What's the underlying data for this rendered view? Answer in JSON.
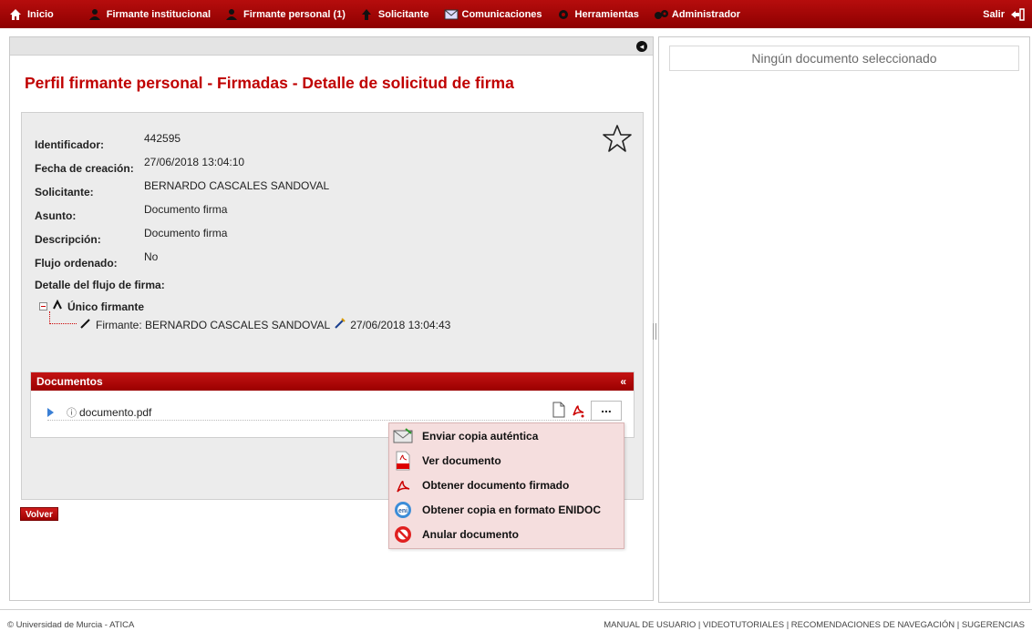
{
  "nav": {
    "items": [
      {
        "label": "Inicio",
        "icon": "home-icon"
      },
      {
        "label": "Firmante institucional",
        "icon": "user-icon"
      },
      {
        "label": "Firmante personal (1)",
        "icon": "user-icon"
      },
      {
        "label": "Solicitante",
        "icon": "arrow-up-icon"
      },
      {
        "label": "Comunicaciones",
        "icon": "envelope-icon"
      },
      {
        "label": "Herramientas",
        "icon": "gear-icon"
      },
      {
        "label": "Administrador",
        "icon": "gears-icon"
      }
    ],
    "logout": {
      "label": "Salir",
      "icon": "logout-icon"
    }
  },
  "right_panel": {
    "empty_text": "Ningún documento seleccionado"
  },
  "page": {
    "title": "Perfil firmante personal - Firmadas - Detalle de solicitud de firma"
  },
  "fields": [
    {
      "label": "Identificador:",
      "value": "442595"
    },
    {
      "label": "Fecha de creación:",
      "value": "27/06/2018 13:04:10"
    },
    {
      "label": "Solicitante:",
      "value": "BERNARDO CASCALES SANDOVAL"
    },
    {
      "label": "Asunto:",
      "value": "Documento firma"
    },
    {
      "label": "Descripción:",
      "value": "Documento firma"
    },
    {
      "label": "Flujo ordenado:",
      "value": "No"
    }
  ],
  "flow": {
    "title": "Detalle del flujo de firma:",
    "root": "Único firmante",
    "signer_text": "Firmante: BERNARDO CASCALES SANDOVAL",
    "signed_date": "27/06/2018 13:04:43"
  },
  "documents": {
    "header": "Documentos",
    "collapse": "«",
    "file_name": "documento.pdf",
    "more_label": "..."
  },
  "menu": [
    {
      "label": "Enviar copia auténtica",
      "icon": "envelope-icon"
    },
    {
      "label": "Ver documento",
      "icon": "pdf-icon"
    },
    {
      "label": "Obtener documento firmado",
      "icon": "acrobat-icon"
    },
    {
      "label": "Obtener copia en formato ENIDOC",
      "icon": "eni-icon"
    },
    {
      "label": "Anular documento",
      "icon": "cancel-icon"
    }
  ],
  "actions": {
    "back_label": "Volver"
  },
  "footer": {
    "left": "© Universidad de Murcia - ATICA",
    "right": "MANUAL DE USUARIO | VIDEOTUTORIALES | RECOMENDACIONES DE NAVEGACIÓN | SUGERENCIAS"
  },
  "colors": {
    "brand": "#a50000",
    "menu_bg": "#f5dede",
    "title": "#c00000"
  }
}
